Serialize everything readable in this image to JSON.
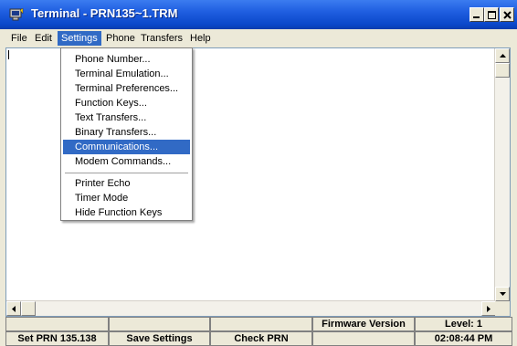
{
  "window": {
    "title": "Terminal - PRN135~1.TRM",
    "icon": "terminal-app-icon"
  },
  "menubar": {
    "items": [
      "File",
      "Edit",
      "Settings",
      "Phone",
      "Transfers",
      "Help"
    ],
    "active": "Settings"
  },
  "settings_menu": {
    "group1": [
      "Phone Number...",
      "Terminal Emulation...",
      "Terminal Preferences...",
      "Function Keys...",
      "Text Transfers...",
      "Binary Transfers...",
      "Communications...",
      "Modem Commands..."
    ],
    "highlighted": "Communications...",
    "group2": [
      "Printer Echo",
      "Timer Mode",
      "Hide Function Keys"
    ]
  },
  "statusbar": {
    "row1": [
      "",
      "",
      "",
      "Firmware Version",
      "Level: 1"
    ],
    "row2": [
      "Set PRN 135.138",
      "Save Settings",
      "Check PRN",
      "",
      "02:08:44 PM"
    ]
  },
  "colors": {
    "titlebar": "#0a47c9",
    "menu_highlight": "#316ac5",
    "window_bg": "#ece9d8"
  }
}
